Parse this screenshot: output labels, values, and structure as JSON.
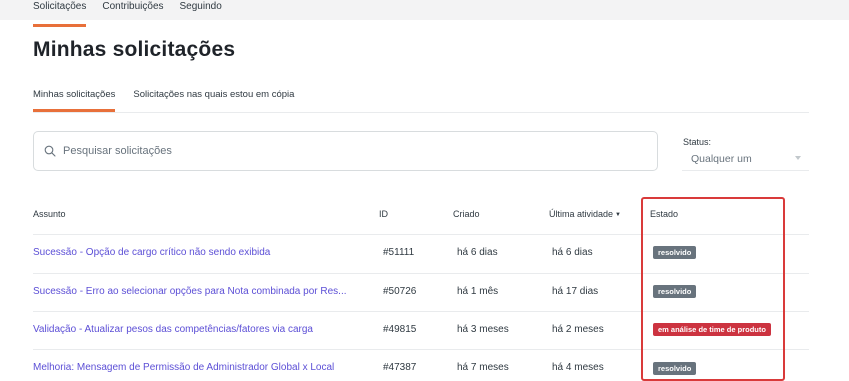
{
  "top_nav": {
    "items": [
      "Solicitações",
      "Contribuições",
      "Seguindo"
    ]
  },
  "page_title": "Minhas solicitações",
  "sub_tabs": [
    "Minhas solicitações",
    "Solicitações nas quais estou em cópia"
  ],
  "search": {
    "placeholder": "Pesquisar solicitações",
    "icon": "search-icon"
  },
  "status_filter": {
    "label": "Status:",
    "value": "Qualquer um"
  },
  "table": {
    "headers": {
      "subject": "Assunto",
      "id": "ID",
      "created": "Criado",
      "last_activity": "Última atividade",
      "last_activity_sort": "▼",
      "status": "Estado"
    },
    "rows": [
      {
        "subject": "Sucessão - Opção de cargo crítico não sendo exibida",
        "id": "#51111",
        "created": "há 6 dias",
        "last_activity": "há 6 dias",
        "status": "resolvido"
      },
      {
        "subject": "Sucessão - Erro ao selecionar opções para Nota combinada por Res...",
        "id": "#50726",
        "created": "há 1 mês",
        "last_activity": "há 17 dias",
        "status": "resolvido"
      },
      {
        "subject": "Validação - Atualizar pesos das competências/fatores via carga",
        "id": "#49815",
        "created": "há 3 meses",
        "last_activity": "há 2 meses",
        "status": "em análise de time de produto"
      },
      {
        "subject": "Melhoria: Mensagem de Permissão de Administrador Global x Local",
        "id": "#47387",
        "created": "há 7 meses",
        "last_activity": "há 4 meses",
        "status": "resolvido"
      }
    ]
  },
  "colors": {
    "accent": "#e8703a",
    "link": "#5c4fd6",
    "badge_solved": "#68737d",
    "badge_review": "#cc3340",
    "highlight": "#d93a3a"
  }
}
